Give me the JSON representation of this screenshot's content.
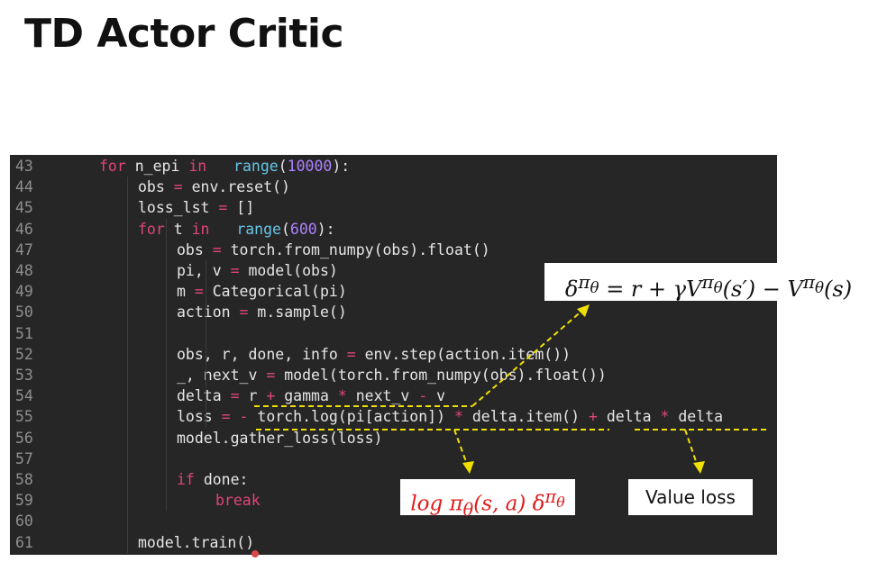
{
  "slide": {
    "title": "TD Actor Critic"
  },
  "code_lines": [
    {
      "num": "43",
      "indent": 1,
      "tokens": [
        [
          "kw",
          "for"
        ],
        [
          "",
          "n_epi "
        ],
        [
          "kw",
          "in"
        ],
        [
          "",
          "  "
        ],
        [
          "fn",
          "range"
        ],
        [
          "",
          "("
        ],
        [
          "num",
          "10000"
        ],
        [
          "",
          "):"
        ]
      ]
    },
    {
      "num": "44",
      "indent": 2,
      "tokens": [
        [
          "",
          "obs "
        ],
        [
          "op",
          "="
        ],
        [
          "",
          ""
        ],
        [
          "",
          "env.reset()"
        ]
      ]
    },
    {
      "num": "45",
      "indent": 2,
      "tokens": [
        [
          "",
          "loss_lst "
        ],
        [
          "op",
          "="
        ],
        [
          "",
          ""
        ],
        [
          "",
          "[]"
        ]
      ]
    },
    {
      "num": "46",
      "indent": 2,
      "tokens": [
        [
          "kw",
          "for"
        ],
        [
          "",
          "t "
        ],
        [
          "kw",
          "in"
        ],
        [
          "",
          "  "
        ],
        [
          "fn",
          "range"
        ],
        [
          "",
          "("
        ],
        [
          "num",
          "600"
        ],
        [
          "",
          "):"
        ]
      ]
    },
    {
      "num": "47",
      "indent": 3,
      "tokens": [
        [
          "",
          "obs "
        ],
        [
          "op",
          "="
        ],
        [
          "",
          ""
        ],
        [
          "",
          "torch.from_numpy(obs).float()"
        ]
      ]
    },
    {
      "num": "48",
      "indent": 3,
      "tokens": [
        [
          "",
          "pi, v "
        ],
        [
          "op",
          "="
        ],
        [
          "",
          ""
        ],
        [
          "",
          "model(obs)"
        ]
      ]
    },
    {
      "num": "49",
      "indent": 3,
      "tokens": [
        [
          "",
          "m "
        ],
        [
          "op",
          "="
        ],
        [
          "",
          ""
        ],
        [
          "",
          "Categorical(pi)"
        ]
      ]
    },
    {
      "num": "50",
      "indent": 3,
      "tokens": [
        [
          "",
          "action "
        ],
        [
          "op",
          "="
        ],
        [
          "",
          ""
        ],
        [
          "",
          "m.sample()"
        ]
      ]
    },
    {
      "num": "51",
      "indent": 0,
      "tokens": []
    },
    {
      "num": "52",
      "indent": 3,
      "tokens": [
        [
          "",
          "obs, r, done, info "
        ],
        [
          "op",
          "="
        ],
        [
          "",
          ""
        ],
        [
          "",
          "env.step(action.item())"
        ]
      ]
    },
    {
      "num": "53",
      "indent": 3,
      "tokens": [
        [
          "",
          "_, next_v "
        ],
        [
          "op",
          "="
        ],
        [
          "",
          ""
        ],
        [
          "",
          "model(torch.from_numpy(obs).float())"
        ]
      ]
    },
    {
      "num": "54",
      "indent": 3,
      "tokens": [
        [
          "",
          "delta "
        ],
        [
          "op",
          "="
        ],
        [
          "",
          ""
        ],
        [
          "",
          "r "
        ],
        [
          "op",
          "+"
        ],
        [
          "",
          ""
        ],
        [
          "",
          "gamma "
        ],
        [
          "op",
          "*"
        ],
        [
          "",
          ""
        ],
        [
          "",
          "next_v "
        ],
        [
          "op",
          "-"
        ],
        [
          "",
          ""
        ],
        [
          "",
          "v"
        ]
      ]
    },
    {
      "num": "55",
      "indent": 3,
      "tokens": [
        [
          "",
          "loss "
        ],
        [
          "op",
          "="
        ],
        [
          "",
          ""
        ],
        [
          "op",
          "-"
        ],
        [
          "",
          "torch.log(pi[action]) "
        ],
        [
          "op",
          "*"
        ],
        [
          "",
          ""
        ],
        [
          "",
          "delta.item() "
        ],
        [
          "op",
          "+"
        ],
        [
          "",
          ""
        ],
        [
          "",
          "delta "
        ],
        [
          "op",
          "*"
        ],
        [
          "",
          ""
        ],
        [
          "",
          "delta"
        ]
      ]
    },
    {
      "num": "56",
      "indent": 3,
      "tokens": [
        [
          "",
          "model.gather_loss(loss)"
        ]
      ]
    },
    {
      "num": "57",
      "indent": 0,
      "tokens": []
    },
    {
      "num": "58",
      "indent": 3,
      "tokens": [
        [
          "kw",
          "if"
        ],
        [
          "",
          "done:"
        ]
      ]
    },
    {
      "num": "59",
      "indent": 4,
      "tokens": [
        [
          "kw",
          "break"
        ]
      ]
    },
    {
      "num": "60",
      "indent": 0,
      "tokens": []
    },
    {
      "num": "61",
      "indent": 2,
      "tokens": [
        [
          "",
          "model.train()"
        ]
      ]
    }
  ],
  "annotations": {
    "td_error": "δ^πθ = r + γV^πθ(s′) − V^πθ(s)",
    "td_error_html": "δ<sup>π<sub>θ</sub></sup> = r + γV<sup>π<sub>θ</sub></sup>(s′) − V<sup>π<sub>θ</sub></sup>(s)",
    "policy_loss": "log πθ(s, a) δ^πθ",
    "policy_loss_html": "log π<sub>θ</sub>(s, a) δ<sup>π<sub>θ</sub></sup>",
    "value_loss": "Value loss"
  },
  "colors": {
    "editor_bg": "#262626",
    "keyword": "#e0457b",
    "builtin": "#66c4e6",
    "number": "#ae81ff",
    "annotation_line": "#f0e000",
    "policy_loss_text": "#e11b1b"
  }
}
